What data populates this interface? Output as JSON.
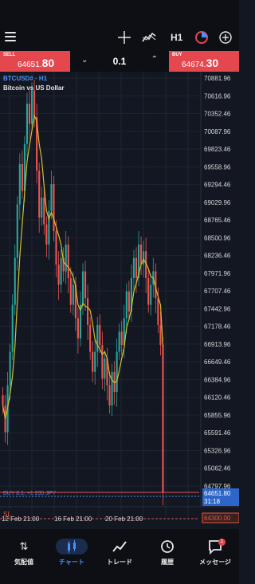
{
  "toolbar": {
    "timeframe": "H1"
  },
  "trade": {
    "sell_label": "SELL",
    "sell_price_main": "64651.",
    "sell_price_big": "80",
    "buy_label": "BUY",
    "buy_price_main": "64674.",
    "buy_price_big": "30",
    "lot": "0.1"
  },
  "chart": {
    "symbol": "BTCUSD# · H1",
    "description": "Bitcoin vs US Dollar",
    "price_levels": [
      "70881.96",
      "70616.96",
      "70352.46",
      "70087.96",
      "69823.46",
      "69558.96",
      "69294.46",
      "69029.96",
      "68765.46",
      "68500.96",
      "68236.46",
      "67971.96",
      "67707.46",
      "67442.96",
      "67178.46",
      "66913.96",
      "66649.46",
      "66384.96",
      "66120.46",
      "65855.96",
      "65591.46",
      "65326.96",
      "65062.46",
      "64797.96"
    ],
    "position_line": "BUY 0.1,  +1 235 JPY",
    "current_price": "64651.80",
    "countdown": "31:18",
    "sl_label": "SL",
    "sl_price": "64300.00",
    "dates": [
      "12 Feb 21:00",
      "16 Feb 21:00",
      "20 Feb 21:00"
    ],
    "colors": {
      "up": "#26a69a",
      "down": "#ef5350",
      "ma": "#d4c02a",
      "position": "#4a90f6",
      "sl": "#e05a3a"
    }
  },
  "chart_data": {
    "type": "candlestick",
    "ma_type": "line",
    "y_range": [
      64500,
      71000
    ],
    "close": [
      66000,
      65600,
      66300,
      66800,
      67500,
      68200,
      69000,
      69600,
      69200,
      69900,
      70500,
      70200,
      70700,
      70300,
      69500,
      68800,
      69100,
      68700,
      68400,
      68900,
      69300,
      68600,
      68100,
      67800,
      68200,
      68000,
      68400,
      67900,
      67500,
      67800,
      67300,
      67000,
      67500,
      68000,
      67600,
      67200,
      66800,
      66500,
      66800,
      67200,
      66900,
      66400,
      66700,
      66300,
      66000,
      66500,
      66200,
      66800,
      67100,
      66900,
      67300,
      67700,
      67400,
      67900,
      68200,
      67900,
      68400,
      68100,
      68300,
      67900,
      67500,
      67800,
      68000,
      67600,
      67200,
      66900,
      64700
    ]
  },
  "nav": [
    {
      "label": "気配値",
      "icon": "quotes-icon"
    },
    {
      "label": "チャート",
      "icon": "chart-icon"
    },
    {
      "label": "トレード",
      "icon": "trade-icon"
    },
    {
      "label": "履歴",
      "icon": "history-icon"
    },
    {
      "label": "メッセージ",
      "icon": "message-icon",
      "badge": "1"
    }
  ]
}
